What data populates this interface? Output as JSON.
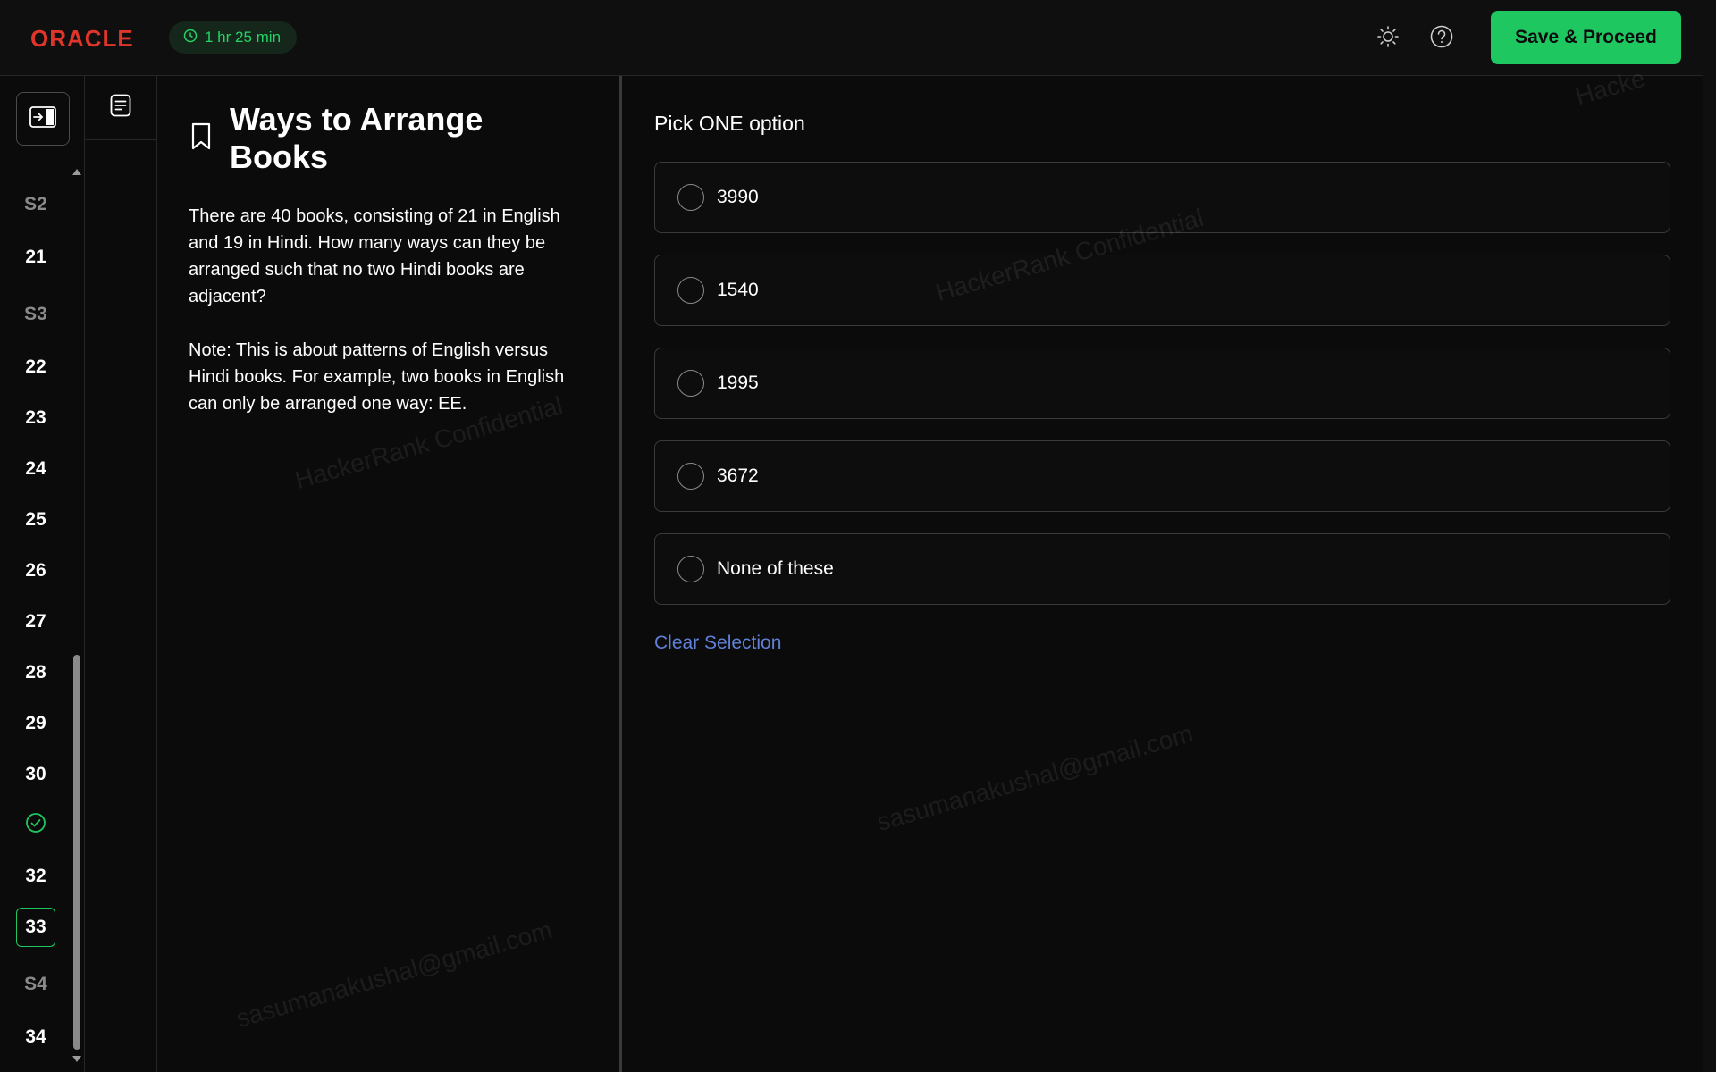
{
  "header": {
    "logo_text": "ORACLE",
    "timer": "1 hr 25 min",
    "save_label": "Save & Proceed",
    "theme_icon": "sun-icon",
    "help_icon": "help-circle-icon"
  },
  "nav": {
    "items": [
      {
        "label": "S2",
        "type": "section"
      },
      {
        "label": "21",
        "type": "question"
      },
      {
        "label": "S3",
        "type": "section"
      },
      {
        "label": "22",
        "type": "question"
      },
      {
        "label": "23",
        "type": "question"
      },
      {
        "label": "24",
        "type": "question"
      },
      {
        "label": "25",
        "type": "question"
      },
      {
        "label": "26",
        "type": "question"
      },
      {
        "label": "27",
        "type": "question"
      },
      {
        "label": "28",
        "type": "question"
      },
      {
        "label": "29",
        "type": "question"
      },
      {
        "label": "30",
        "type": "question"
      },
      {
        "label": "",
        "type": "answered",
        "icon": "check-circle-icon"
      },
      {
        "label": "32",
        "type": "question"
      },
      {
        "label": "33",
        "type": "current"
      },
      {
        "label": "S4",
        "type": "section"
      },
      {
        "label": "34",
        "type": "question"
      }
    ]
  },
  "question": {
    "title": "Ways to Arrange Books",
    "body": "There are 40 books, consisting of 21 in English and 19 in Hindi. How many ways can they be arranged such that no two Hindi books are adjacent?",
    "note": "Note: This is about patterns of English versus Hindi books.  For example, two books in English can only be arranged one way: EE."
  },
  "answer": {
    "prompt": "Pick ONE option",
    "options": [
      "3990",
      "1540",
      "1995",
      "3672",
      "None of these"
    ],
    "clear_label": "Clear Selection"
  },
  "watermarks": {
    "company": "HackerRank Confidential",
    "email": "sasumanakushal@gmail.com",
    "corner": "Hacke"
  },
  "colors": {
    "accent": "#1ec760",
    "brand": "#e0352b",
    "link": "#5f80d6"
  }
}
